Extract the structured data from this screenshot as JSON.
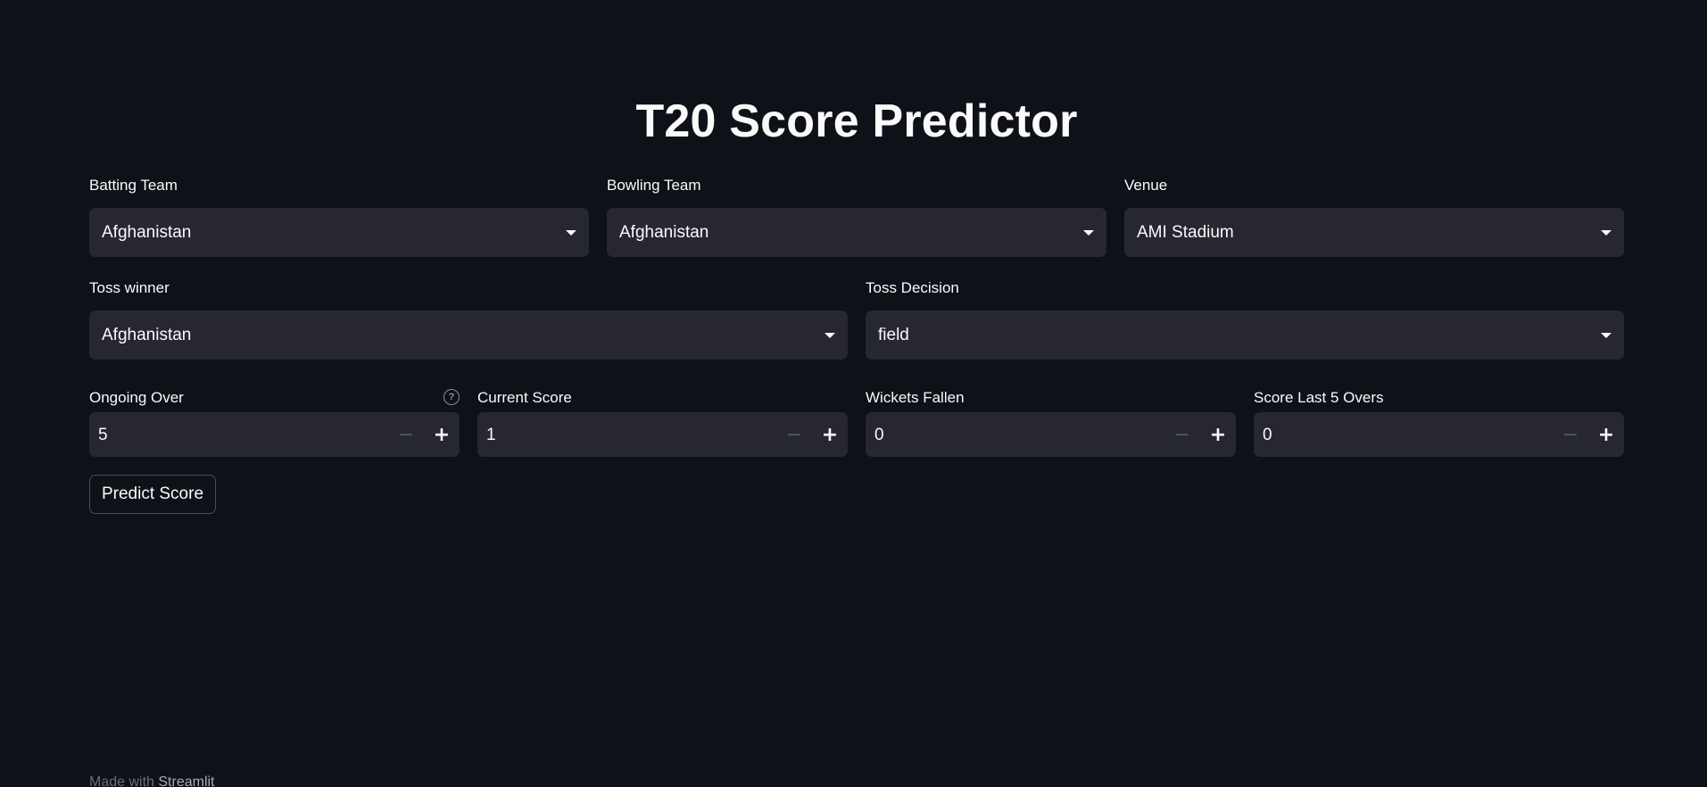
{
  "title": "T20 Score Predictor",
  "selects": {
    "batting_team": {
      "label": "Batting Team",
      "value": "Afghanistan"
    },
    "bowling_team": {
      "label": "Bowling Team",
      "value": "Afghanistan"
    },
    "venue": {
      "label": "Venue",
      "value": "AMI Stadium"
    },
    "toss_winner": {
      "label": "Toss winner",
      "value": "Afghanistan"
    },
    "toss_decision": {
      "label": "Toss Decision",
      "value": "field"
    }
  },
  "numbers": {
    "ongoing_over": {
      "label": "Ongoing Over",
      "value": "5"
    },
    "current_score": {
      "label": "Current Score",
      "value": "1"
    },
    "wickets_fallen": {
      "label": "Wickets Fallen",
      "value": "0"
    },
    "score_last_5": {
      "label": "Score Last 5 Overs",
      "value": "0"
    }
  },
  "stepper": {
    "minus": "−",
    "plus": "+"
  },
  "help_glyph": "?",
  "predict_button": "Predict Score",
  "footer": {
    "prefix": "Made with ",
    "link": "Streamlit"
  }
}
